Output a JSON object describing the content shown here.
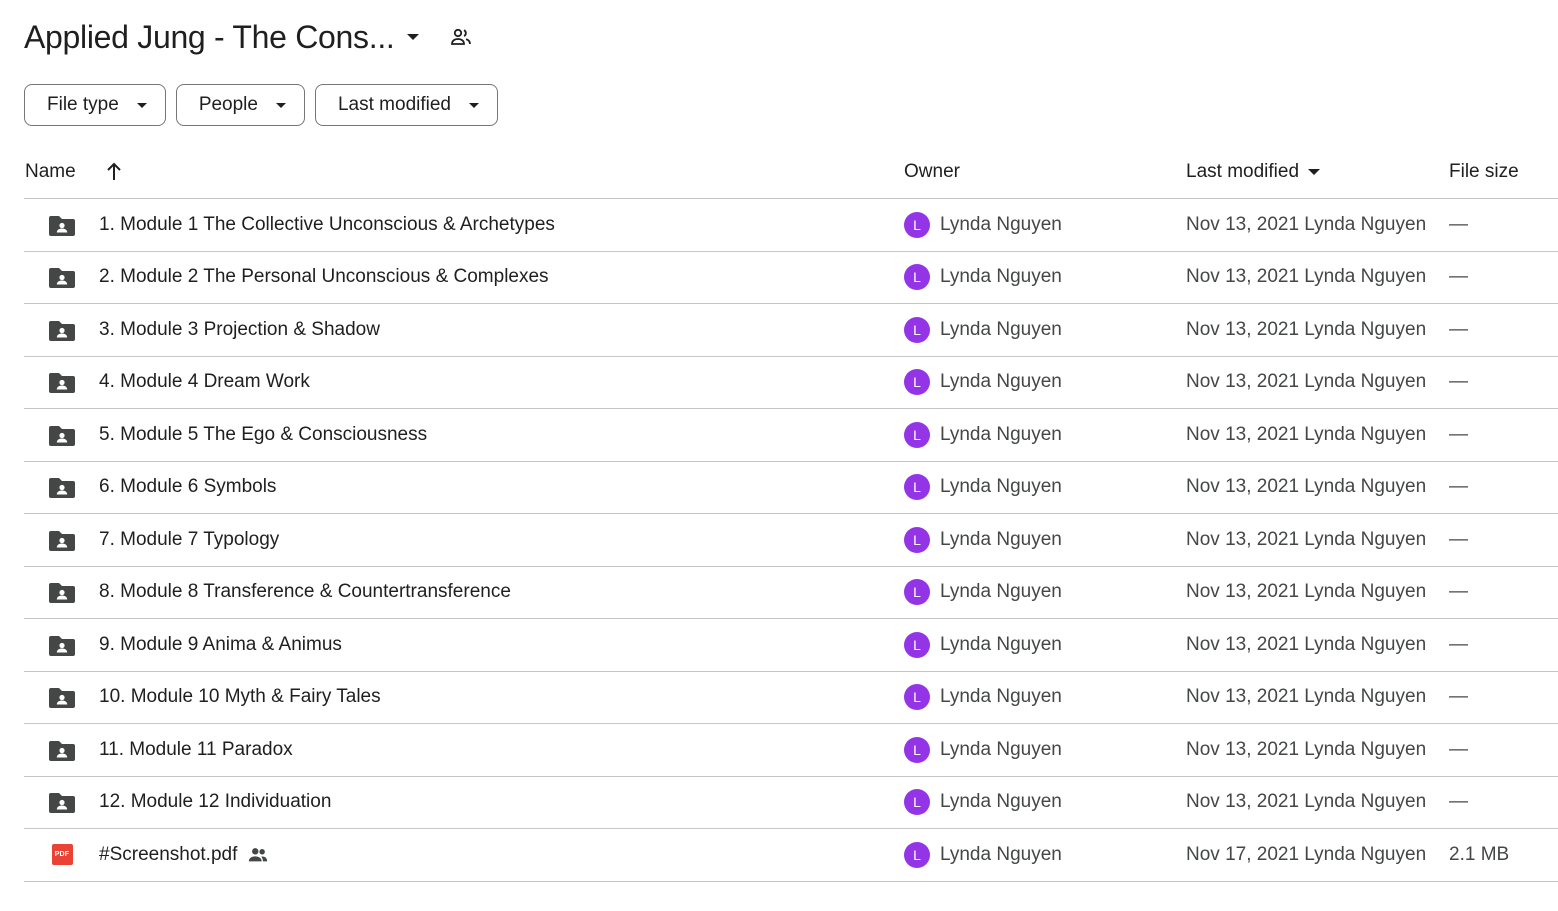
{
  "header": {
    "title": "Applied Jung - The Cons...",
    "icons": {
      "title_caret": "caret-down-icon",
      "share": "shared-people-icon"
    }
  },
  "filters": [
    {
      "label": "File type"
    },
    {
      "label": "People"
    },
    {
      "label": "Last modified"
    }
  ],
  "columns": {
    "name": "Name",
    "owner": "Owner",
    "last_modified": "Last modified",
    "file_size": "File size"
  },
  "colors": {
    "avatar": "#9334e6",
    "pdf": "#ea4335",
    "folder": "#444746"
  },
  "rows": [
    {
      "type": "folder",
      "name": "1. Module 1 The Collective Unconscious & Archetypes",
      "owner_initial": "L",
      "owner": "Lynda Nguyen",
      "modified": "Nov 13, 2021 Lynda Nguyen",
      "size": "—"
    },
    {
      "type": "folder",
      "name": "2. Module 2 The Personal Unconscious & Complexes",
      "owner_initial": "L",
      "owner": "Lynda Nguyen",
      "modified": "Nov 13, 2021 Lynda Nguyen",
      "size": "—"
    },
    {
      "type": "folder",
      "name": "3. Module 3 Projection & Shadow",
      "owner_initial": "L",
      "owner": "Lynda Nguyen",
      "modified": "Nov 13, 2021 Lynda Nguyen",
      "size": "—"
    },
    {
      "type": "folder",
      "name": "4. Module 4 Dream Work",
      "owner_initial": "L",
      "owner": "Lynda Nguyen",
      "modified": "Nov 13, 2021 Lynda Nguyen",
      "size": "—"
    },
    {
      "type": "folder",
      "name": "5. Module 5 The Ego & Consciousness",
      "owner_initial": "L",
      "owner": "Lynda Nguyen",
      "modified": "Nov 13, 2021 Lynda Nguyen",
      "size": "—"
    },
    {
      "type": "folder",
      "name": "6. Module 6 Symbols",
      "owner_initial": "L",
      "owner": "Lynda Nguyen",
      "modified": "Nov 13, 2021 Lynda Nguyen",
      "size": "—"
    },
    {
      "type": "folder",
      "name": "7. Module 7 Typology",
      "owner_initial": "L",
      "owner": "Lynda Nguyen",
      "modified": "Nov 13, 2021 Lynda Nguyen",
      "size": "—"
    },
    {
      "type": "folder",
      "name": "8. Module 8 Transference & Countertransference",
      "owner_initial": "L",
      "owner": "Lynda Nguyen",
      "modified": "Nov 13, 2021 Lynda Nguyen",
      "size": "—"
    },
    {
      "type": "folder",
      "name": "9. Module 9 Anima & Animus",
      "owner_initial": "L",
      "owner": "Lynda Nguyen",
      "modified": "Nov 13, 2021 Lynda Nguyen",
      "size": "—"
    },
    {
      "type": "folder",
      "name": "10. Module 10 Myth & Fairy Tales",
      "owner_initial": "L",
      "owner": "Lynda Nguyen",
      "modified": "Nov 13, 2021 Lynda Nguyen",
      "size": "—"
    },
    {
      "type": "folder",
      "name": "11. Module 11 Paradox",
      "owner_initial": "L",
      "owner": "Lynda Nguyen",
      "modified": "Nov 13, 2021 Lynda Nguyen",
      "size": "—"
    },
    {
      "type": "folder",
      "name": "12. Module 12 Individuation",
      "owner_initial": "L",
      "owner": "Lynda Nguyen",
      "modified": "Nov 13, 2021 Lynda Nguyen",
      "size": "—"
    },
    {
      "type": "pdf",
      "name": "#Screenshot.pdf",
      "shared": true,
      "owner_initial": "L",
      "owner": "Lynda Nguyen",
      "modified": "Nov 17, 2021 Lynda Nguyen",
      "size": "2.1 MB"
    }
  ]
}
